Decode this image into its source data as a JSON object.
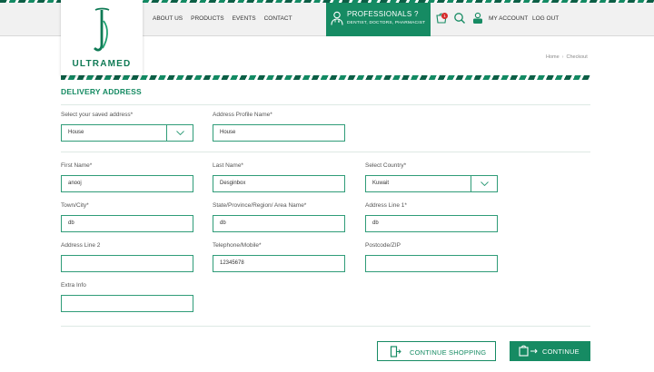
{
  "brand": {
    "name": "ULTRAMED",
    "accent": "#168b63"
  },
  "nav": [
    "ABOUT US",
    "PRODUCTS",
    "EVENTS",
    "CONTACT"
  ],
  "professionals": {
    "title": "PROFESSIONALS ?",
    "subtitle": "DENTIST, DOCTORS, PHARMACIST"
  },
  "header": {
    "cart_count": "1",
    "account": "MY ACCOUNT",
    "logout": "LOG OUT"
  },
  "breadcrumb": {
    "home": "Home",
    "current": "Checkout"
  },
  "section_title": "DELIVERY ADDRESS",
  "form": {
    "saved_address": {
      "label": "Select your saved address*",
      "value": "House"
    },
    "profile_name": {
      "label": "Address Profile Name*",
      "value": "House"
    },
    "first_name": {
      "label": "First Name*",
      "value": "anooj"
    },
    "last_name": {
      "label": "Last Name*",
      "value": "Desginbox"
    },
    "country": {
      "label": "Select Country*",
      "value": "Kuwait"
    },
    "town": {
      "label": "Town/City*",
      "value": "db"
    },
    "province": {
      "label": "State/Province/Region/ Area Name*",
      "value": "db"
    },
    "address1": {
      "label": "Address Line 1*",
      "value": "db"
    },
    "address2": {
      "label": "Address Line 2",
      "value": ""
    },
    "telephone": {
      "label": "Telephone/Mobile*",
      "value": "12345678"
    },
    "postcode": {
      "label": "Postcode/ZIP",
      "value": ""
    },
    "extra": {
      "label": "Extra Info",
      "value": ""
    }
  },
  "buttons": {
    "continue_shopping": "CONTINUE SHOPPING",
    "continue": "CONTINUE"
  }
}
